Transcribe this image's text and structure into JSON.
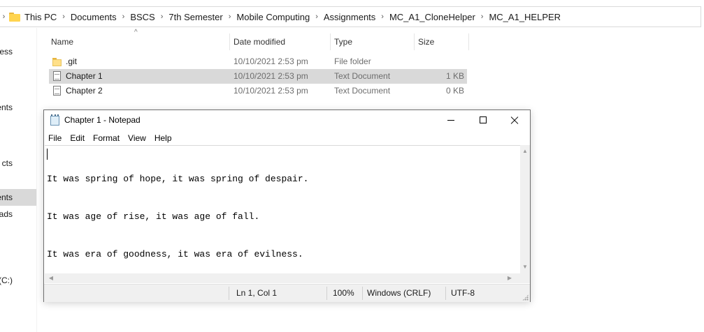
{
  "explorer": {
    "breadcrumb": [
      "This PC",
      "Documents",
      "BSCS",
      "7th Semester",
      "Mobile Computing",
      "Assignments",
      "MC_A1_CloneHelper",
      "MC_A1_HELPER"
    ],
    "sidebar": [
      "ess",
      "ents",
      "cts",
      "ents",
      "ads",
      "sk (C:)"
    ],
    "columns": {
      "name": "Name",
      "date": "Date modified",
      "type": "Type",
      "size": "Size"
    },
    "files": [
      {
        "name": ".git",
        "date": "10/10/2021 2:53 pm",
        "type": "File folder",
        "size": "",
        "icon": "folder-icon"
      },
      {
        "name": "Chapter 1",
        "date": "10/10/2021 2:53 pm",
        "type": "Text Document",
        "size": "1 KB",
        "icon": "text-document-icon"
      },
      {
        "name": "Chapter 2",
        "date": "10/10/2021 2:53 pm",
        "type": "Text Document",
        "size": "0 KB",
        "icon": "text-document-icon"
      }
    ]
  },
  "notepad": {
    "title": "Chapter 1 - Notepad",
    "menu": [
      "File",
      "Edit",
      "Format",
      "View",
      "Help"
    ],
    "lines": [
      "It was spring of hope, it was spring of despair.",
      "It was age of rise, it was age of fall.",
      "It was era of goodness, it was era of evilness."
    ],
    "status": {
      "position": "Ln 1, Col 1",
      "zoom": "100%",
      "line_ending": "Windows (CRLF)",
      "encoding": "UTF-8"
    }
  }
}
